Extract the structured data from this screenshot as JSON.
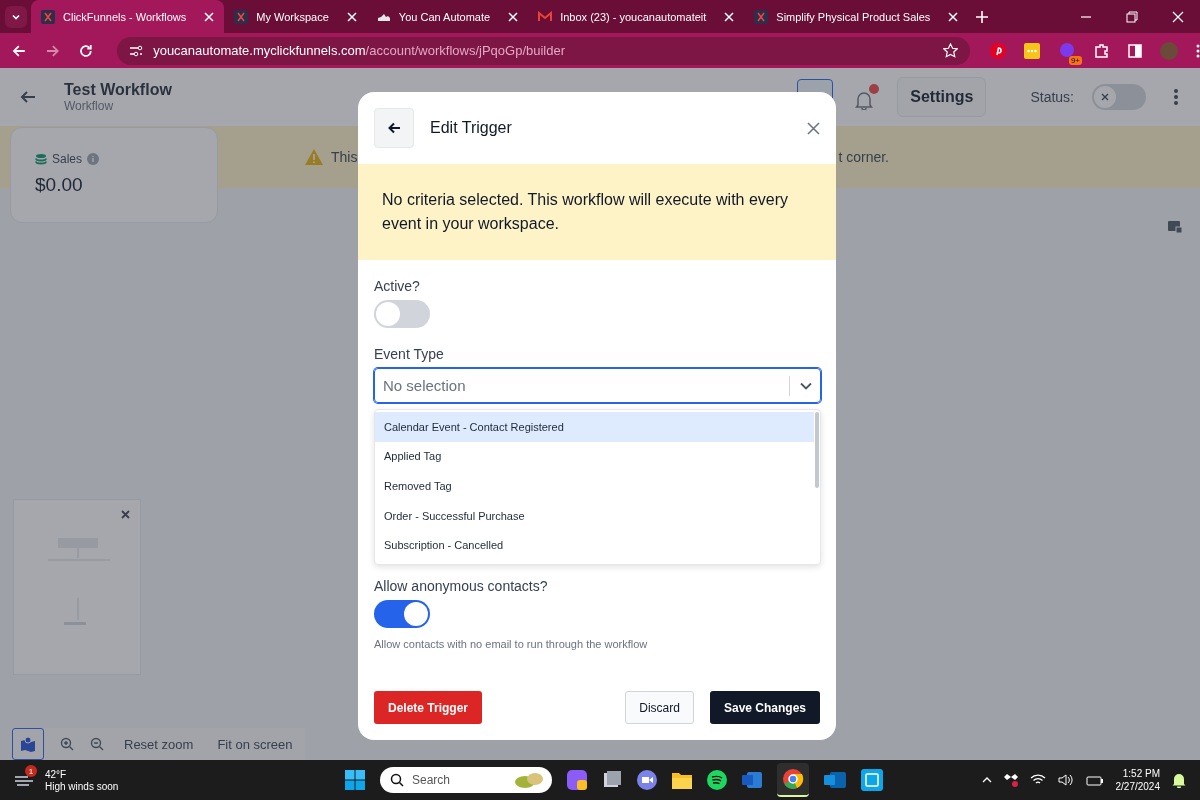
{
  "browser": {
    "tabs": [
      {
        "title": "ClickFunnels - Workflows",
        "selected": true
      },
      {
        "title": "My Workspace",
        "selected": false
      },
      {
        "title": "You Can Automate",
        "selected": false
      },
      {
        "title": "Inbox (23) - youcanautomateit",
        "selected": false
      },
      {
        "title": "Simplify Physical Product Sales",
        "selected": false
      }
    ],
    "url_host": "youcanautomate.myclickfunnels.com",
    "url_path": "/account/workflows/jPqoGp/builder",
    "extension_badge": "9+"
  },
  "header": {
    "title": "Test Workflow",
    "subtitle": "Workflow",
    "settings_button": "Settings",
    "status_label": "Status:",
    "status_on": false
  },
  "banner": {
    "text_start": "This",
    "text_end": "t corner."
  },
  "stats": {
    "label": "Sales",
    "value": "$0.00"
  },
  "canvas_toolbar": {
    "reset_zoom": "Reset zoom",
    "fit_on_screen": "Fit on screen"
  },
  "modal": {
    "title": "Edit Trigger",
    "notice": "No criteria selected. This workflow will execute with every event in your workspace.",
    "active": {
      "label": "Active?",
      "on": false
    },
    "event_type": {
      "label": "Event Type",
      "placeholder": "No selection",
      "expanded": true,
      "options": [
        {
          "label": "Calendar Event - Contact Registered",
          "selected": true
        },
        {
          "label": "Applied Tag",
          "selected": false
        },
        {
          "label": "Removed Tag",
          "selected": false
        },
        {
          "label": "Order - Successful Purchase",
          "selected": false
        },
        {
          "label": "Subscription - Cancelled",
          "selected": false
        }
      ]
    },
    "anonymous": {
      "label": "Allow anonymous contacts?",
      "on": true,
      "help": "Allow contacts with no email to run through the workflow"
    },
    "delete_button": "Delete Trigger",
    "discard_button": "Discard",
    "save_button": "Save Changes"
  },
  "taskbar": {
    "weather_badge": "1",
    "temperature": "42°F",
    "forecast": "High winds soon",
    "search_placeholder": "Search",
    "time": "1:52 PM",
    "date": "2/27/2024"
  }
}
